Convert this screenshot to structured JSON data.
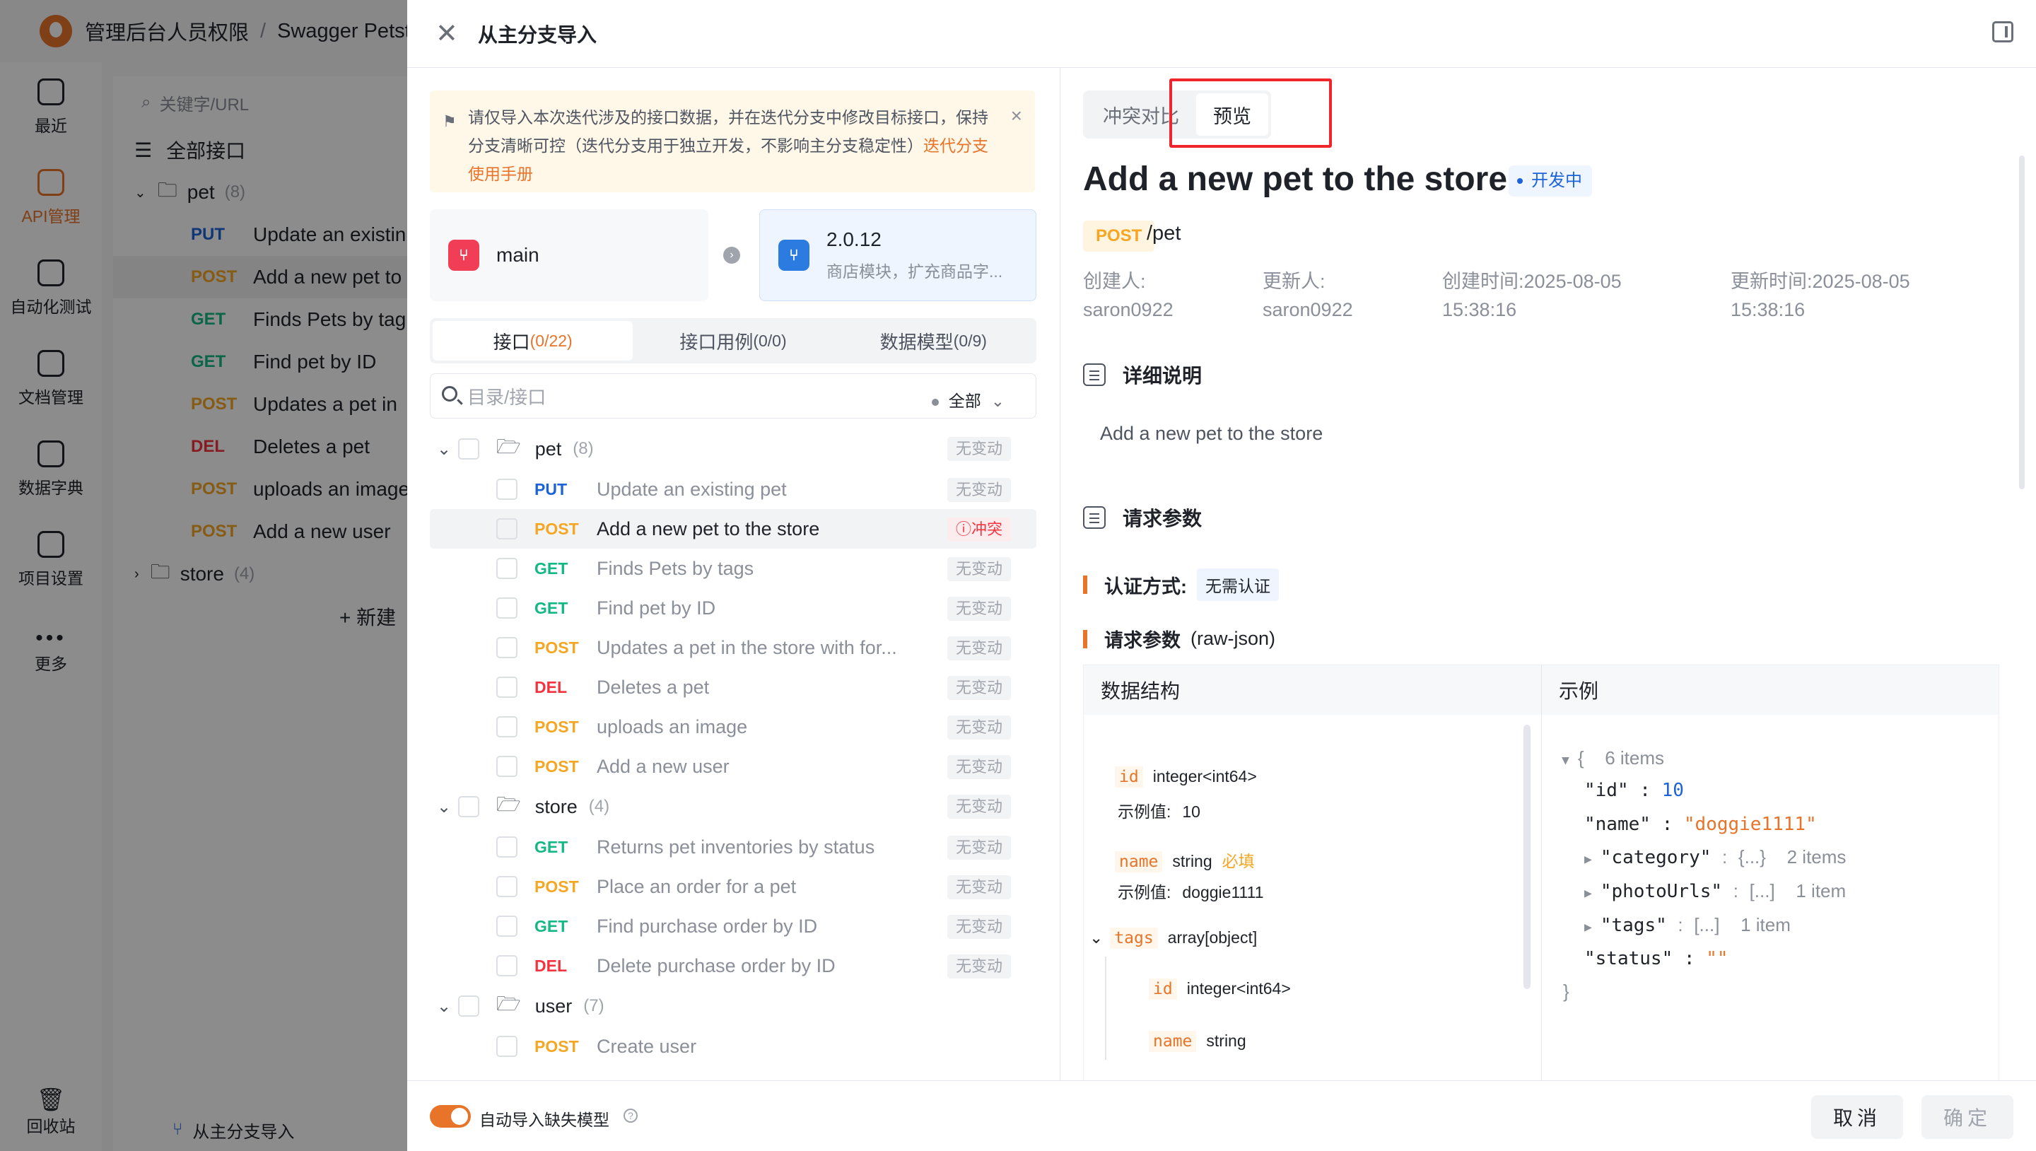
{
  "background": {
    "breadcrumb": [
      "管理后台人员权限",
      "Swagger Petste"
    ],
    "nav": [
      {
        "label": "最近",
        "active": false
      },
      {
        "label": "API管理",
        "active": true
      },
      {
        "label": "自动化测试",
        "active": false
      },
      {
        "label": "文档管理",
        "active": false
      },
      {
        "label": "数据字典",
        "active": false
      },
      {
        "label": "项目设置",
        "active": false
      },
      {
        "label": "更多",
        "active": false
      }
    ],
    "nav_bottom": "回收站",
    "search_placeholder": "关键字/URL",
    "all_label": "全部接口",
    "group": {
      "name": "pet",
      "count": "(8)"
    },
    "rows": [
      {
        "method": "PUT",
        "name": "Update an existin"
      },
      {
        "method": "POST",
        "name": "Add a new pet to"
      },
      {
        "method": "GET",
        "name": "Finds Pets by tag"
      },
      {
        "method": "GET",
        "name": "Find pet by ID"
      },
      {
        "method": "POST",
        "name": "Updates a pet in"
      },
      {
        "method": "DEL",
        "name": "Deletes a pet"
      },
      {
        "method": "POST",
        "name": "uploads an image"
      },
      {
        "method": "POST",
        "name": "Add a new user"
      }
    ],
    "store": {
      "name": "store",
      "count": "(4)"
    },
    "new_label": "+ 新建",
    "footer_label": "从主分支导入"
  },
  "drawer": {
    "title": "从主分支导入",
    "notice": {
      "text": "请仅导入本次迭代涉及的接口数据，并在迭代分支中修改目标接口，保持分支清晰可控（迭代分支用于独立开发，不影响主分支稳定性）",
      "link": "迭代分支使用手册"
    },
    "source_branch": {
      "name": "main"
    },
    "target_branch": {
      "name": "2.0.12",
      "desc": "商店模块，扩充商品字..."
    },
    "tabs": [
      {
        "label": "接口",
        "count": "(0/22)",
        "active": true
      },
      {
        "label": "接口用例",
        "count": "(0/0)",
        "active": false
      },
      {
        "label": "数据模型",
        "count": "(0/9)",
        "active": false
      }
    ],
    "search_placeholder": "目录/接口",
    "filter_label": "全部",
    "groups": [
      {
        "name": "pet",
        "count": "(8)",
        "badge": "无变动",
        "expanded": true,
        "items": [
          {
            "method": "PUT",
            "name": "Update an existing pet",
            "badge": "无变动",
            "conflict": false
          },
          {
            "method": "POST",
            "name": "Add a new pet to the store",
            "badge": "冲突",
            "conflict": true
          },
          {
            "method": "GET",
            "name": "Finds Pets by tags",
            "badge": "无变动",
            "conflict": false
          },
          {
            "method": "GET",
            "name": "Find pet by ID",
            "badge": "无变动",
            "conflict": false
          },
          {
            "method": "POST",
            "name": "Updates a pet in the store with for...",
            "badge": "无变动",
            "conflict": false
          },
          {
            "method": "DEL",
            "name": "Deletes a pet",
            "badge": "无变动",
            "conflict": false
          },
          {
            "method": "POST",
            "name": "uploads an image",
            "badge": "无变动",
            "conflict": false
          },
          {
            "method": "POST",
            "name": "Add a new user",
            "badge": "无变动",
            "conflict": false
          }
        ]
      },
      {
        "name": "store",
        "count": "(4)",
        "badge": "无变动",
        "expanded": true,
        "items": [
          {
            "method": "GET",
            "name": "Returns pet inventories by status",
            "badge": "无变动",
            "conflict": false
          },
          {
            "method": "POST",
            "name": "Place an order for a pet",
            "badge": "无变动",
            "conflict": false
          },
          {
            "method": "GET",
            "name": "Find purchase order by ID",
            "badge": "无变动",
            "conflict": false
          },
          {
            "method": "DEL",
            "name": "Delete purchase order by ID",
            "badge": "无变动",
            "conflict": false
          }
        ]
      },
      {
        "name": "user",
        "count": "(7)",
        "badge": "",
        "expanded": true,
        "items": [
          {
            "method": "POST",
            "name": "Create user",
            "badge": "",
            "conflict": false
          }
        ]
      }
    ],
    "preview": {
      "segments": [
        "冲突对比",
        "预览"
      ],
      "active_segment": "预览",
      "title": "Add a new pet to the store",
      "status": "开发中",
      "method": "POST",
      "path": "/pet",
      "meta": [
        {
          "label": "创建人:",
          "value": "saron0922"
        },
        {
          "label": "更新人:",
          "value": "saron0922"
        },
        {
          "label": "创建时间:",
          "value": "2025-08-05 15:38:16"
        },
        {
          "label": "更新时间:",
          "value": "2025-08-05 15:38:16"
        }
      ],
      "section_desc": "详细说明",
      "description": "Add a new pet to the store",
      "section_params": "请求参数",
      "auth_label": "认证方式:",
      "auth_value": "无需认证",
      "body_label": "请求参数",
      "body_type": "(raw-json)",
      "schema_header": "数据结构",
      "example_header": "示例",
      "example_value_label": "示例值:",
      "required_label": "必填",
      "fields": [
        {
          "key": "id",
          "type": "integer<int64>",
          "example": "10"
        },
        {
          "key": "name",
          "type": "string",
          "example": "doggie1111"
        },
        {
          "key": "tags",
          "type": "array[object]"
        },
        {
          "key": "id",
          "type": "integer<int64>"
        },
        {
          "key": "name",
          "type": "string"
        }
      ],
      "json_example": {
        "root_count": "6 items",
        "id": "10",
        "name": "\"doggie1111\"",
        "category_summary": "{...}",
        "category_count": "2 items",
        "photoUrls_summary": "[...]",
        "photoUrls_count": "1 item",
        "tags_summary": "[...]",
        "tags_count": "1 item",
        "status": "\"\""
      }
    },
    "footer": {
      "toggle_label": "自动导入缺失模型",
      "toggle_on": true,
      "cancel": "取消",
      "confirm": "确定"
    }
  }
}
